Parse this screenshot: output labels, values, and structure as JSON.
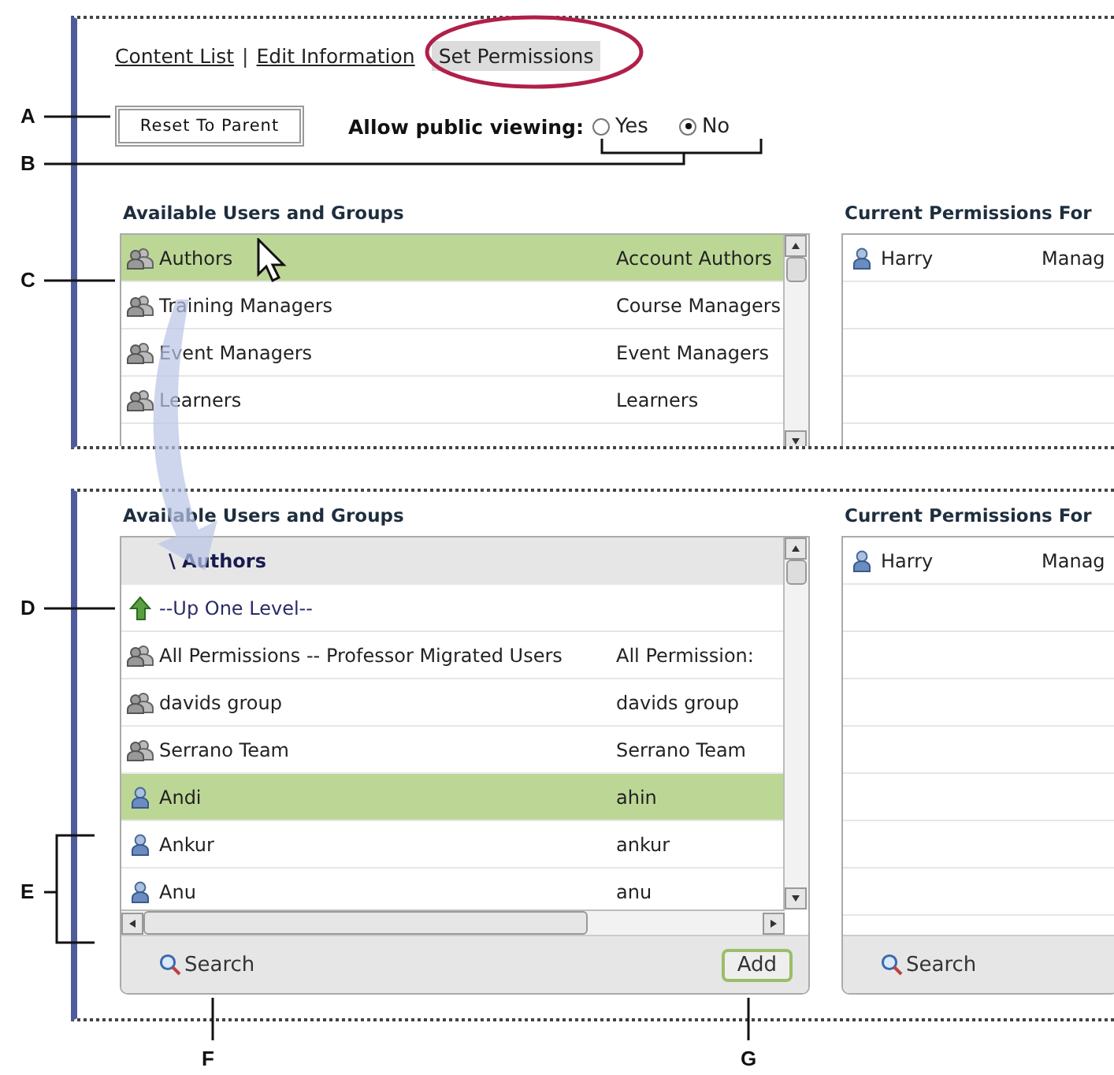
{
  "nav": [
    {
      "label": "Content List",
      "selected": false,
      "separator": "|"
    },
    {
      "label": "Edit Information",
      "selected": false
    },
    {
      "label": "Set Permissions",
      "selected": true
    }
  ],
  "reset_button": "Reset To Parent",
  "public_viewing": {
    "label": "Allow public viewing:",
    "options": [
      {
        "label": "Yes",
        "selected": false
      },
      {
        "label": "No",
        "selected": true
      }
    ]
  },
  "panels": [
    {
      "available": {
        "heading": "Available Users and Groups",
        "rows": [
          {
            "kind": "group",
            "name": "Authors",
            "login": "Account Authors",
            "selected": true
          },
          {
            "kind": "group",
            "name": "Training Managers",
            "login": "Course Managers",
            "selected": false
          },
          {
            "kind": "group",
            "name": "Event Managers",
            "login": "Event Managers",
            "selected": false
          },
          {
            "kind": "group",
            "name": "Learners",
            "login": "Learners",
            "selected": false
          }
        ]
      },
      "current": {
        "heading": "Current Permissions For",
        "rows": [
          {
            "kind": "user",
            "name": "Harry",
            "login": "Manag"
          }
        ]
      }
    },
    {
      "available": {
        "heading": "Available Users and Groups",
        "path": "\\ Authors",
        "rows": [
          {
            "kind": "up",
            "name": "--Up One Level--",
            "selected": false
          },
          {
            "kind": "group",
            "name": "All Permissions -- Professor Migrated Users",
            "login": "All Permission:",
            "selected": false
          },
          {
            "kind": "group",
            "name": "davids group",
            "login": "davids group",
            "selected": false
          },
          {
            "kind": "group",
            "name": "Serrano Team",
            "login": "Serrano Team",
            "selected": false
          },
          {
            "kind": "user",
            "name": "Andi",
            "login": "ahin",
            "selected": true
          },
          {
            "kind": "user",
            "name": "Ankur",
            "login": "ankur",
            "selected": false
          },
          {
            "kind": "user",
            "name": "Anu",
            "login": "anu",
            "selected": false
          }
        ],
        "search": "Search",
        "add": "Add"
      },
      "current": {
        "heading": "Current Permissions For",
        "rows": [
          {
            "kind": "user",
            "name": "Harry",
            "login": "Manag"
          }
        ],
        "search": "Search"
      }
    }
  ],
  "callouts": [
    {
      "label": "A"
    },
    {
      "label": "B"
    },
    {
      "label": "C"
    },
    {
      "label": "D"
    },
    {
      "label": "E"
    },
    {
      "label": "F"
    },
    {
      "label": "G"
    }
  ]
}
